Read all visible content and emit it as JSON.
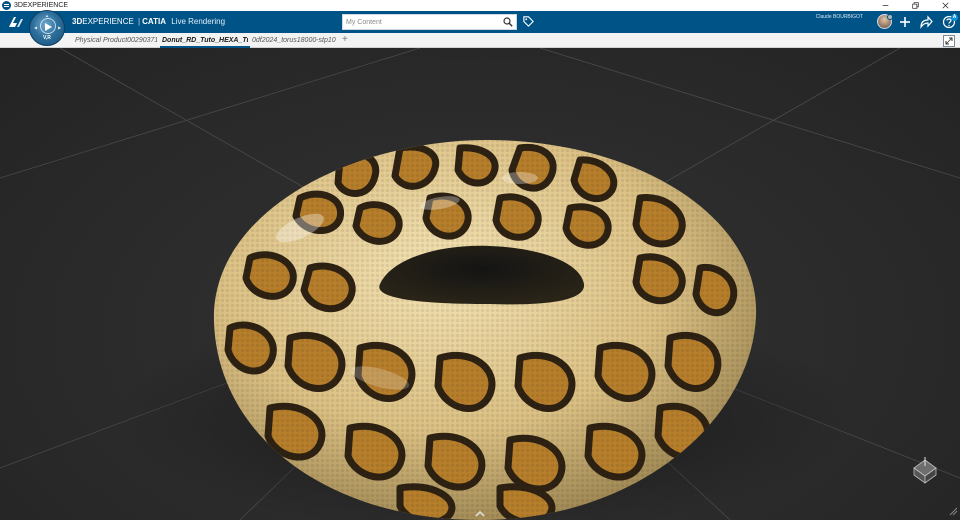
{
  "window": {
    "title": "3DEXPERIENCE",
    "controls": [
      "minimize-icon",
      "restore-icon",
      "close-icon"
    ]
  },
  "header": {
    "brand_bold": "3D",
    "brand_experience": "EXPERIENCE",
    "brand_separator": "|",
    "brand_product": "CATIA",
    "brand_app": "Live Rendering",
    "compass_label": "V,R",
    "search_placeholder": "My Content",
    "user_name": "Claude BOURBIGOT",
    "icons": [
      "search-icon",
      "tag-icon",
      "plus-icon",
      "share-icon",
      "help-icon"
    ]
  },
  "tabs": [
    {
      "label": "Physical Product00290371",
      "active": false
    },
    {
      "label": "Donut_RD_Tuto_HEXA_Tur",
      "active": true
    },
    {
      "label": "0df2024_torus18000-stp10",
      "active": false
    }
  ],
  "tab_add_label": "+",
  "colors": {
    "header_bg": "#005386",
    "viewport_bg": "#2b2b2b",
    "torus_base": "#e8d29a",
    "pattern_dark": "#2e2213",
    "pattern_fill": "#b77f2b"
  }
}
